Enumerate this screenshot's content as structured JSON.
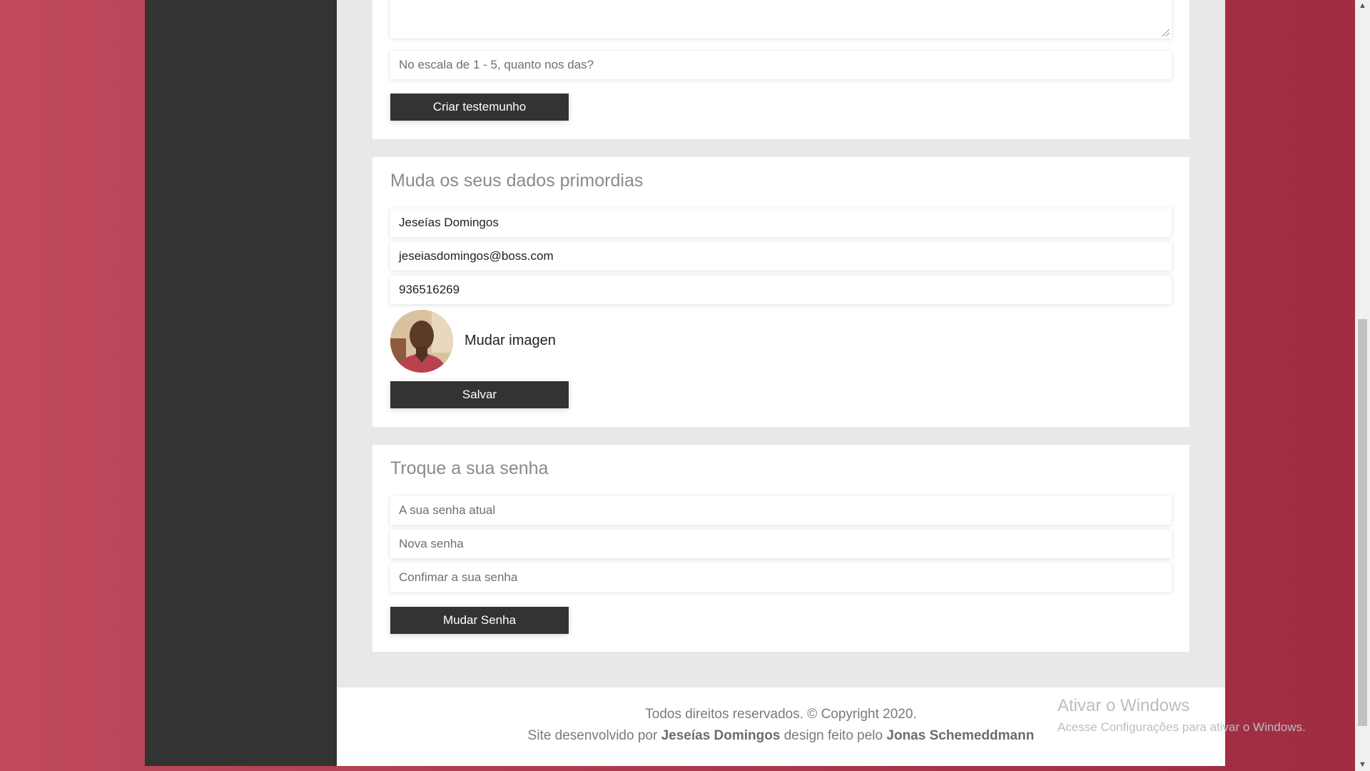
{
  "testimonial": {
    "rating_placeholder": "No escala de 1 - 5, quanto nos das?",
    "submit_label": "Criar testemunho"
  },
  "profile": {
    "title": "Muda os seus dados primordias",
    "name_value": "Jeseías Domingos",
    "email_value": "jeseiasdomingos@boss.com",
    "phone_value": "936516269",
    "change_image_label": "Mudar imagen",
    "save_label": "Salvar"
  },
  "password": {
    "title": "Troque a sua senha",
    "current_placeholder": "A sua senha atual",
    "new_placeholder": "Nova senha",
    "confirm_placeholder": "Confimar a sua senha",
    "submit_label": "Mudar Senha"
  },
  "footer": {
    "line1": "Todos direitos reservados. © Copyright 2020.",
    "line2_prefix": "Site desenvolvido por ",
    "developer": "Jeseías Domingos",
    "line2_middle": " design feito pelo ",
    "designer": "Jonas Schemeddmann"
  },
  "watermark": {
    "title": "Ativar o Windows",
    "subtitle": "Acesse Configurações para ativar o Windows."
  },
  "scrollbar": {
    "up_icon": "▲",
    "down_icon": "▼"
  }
}
